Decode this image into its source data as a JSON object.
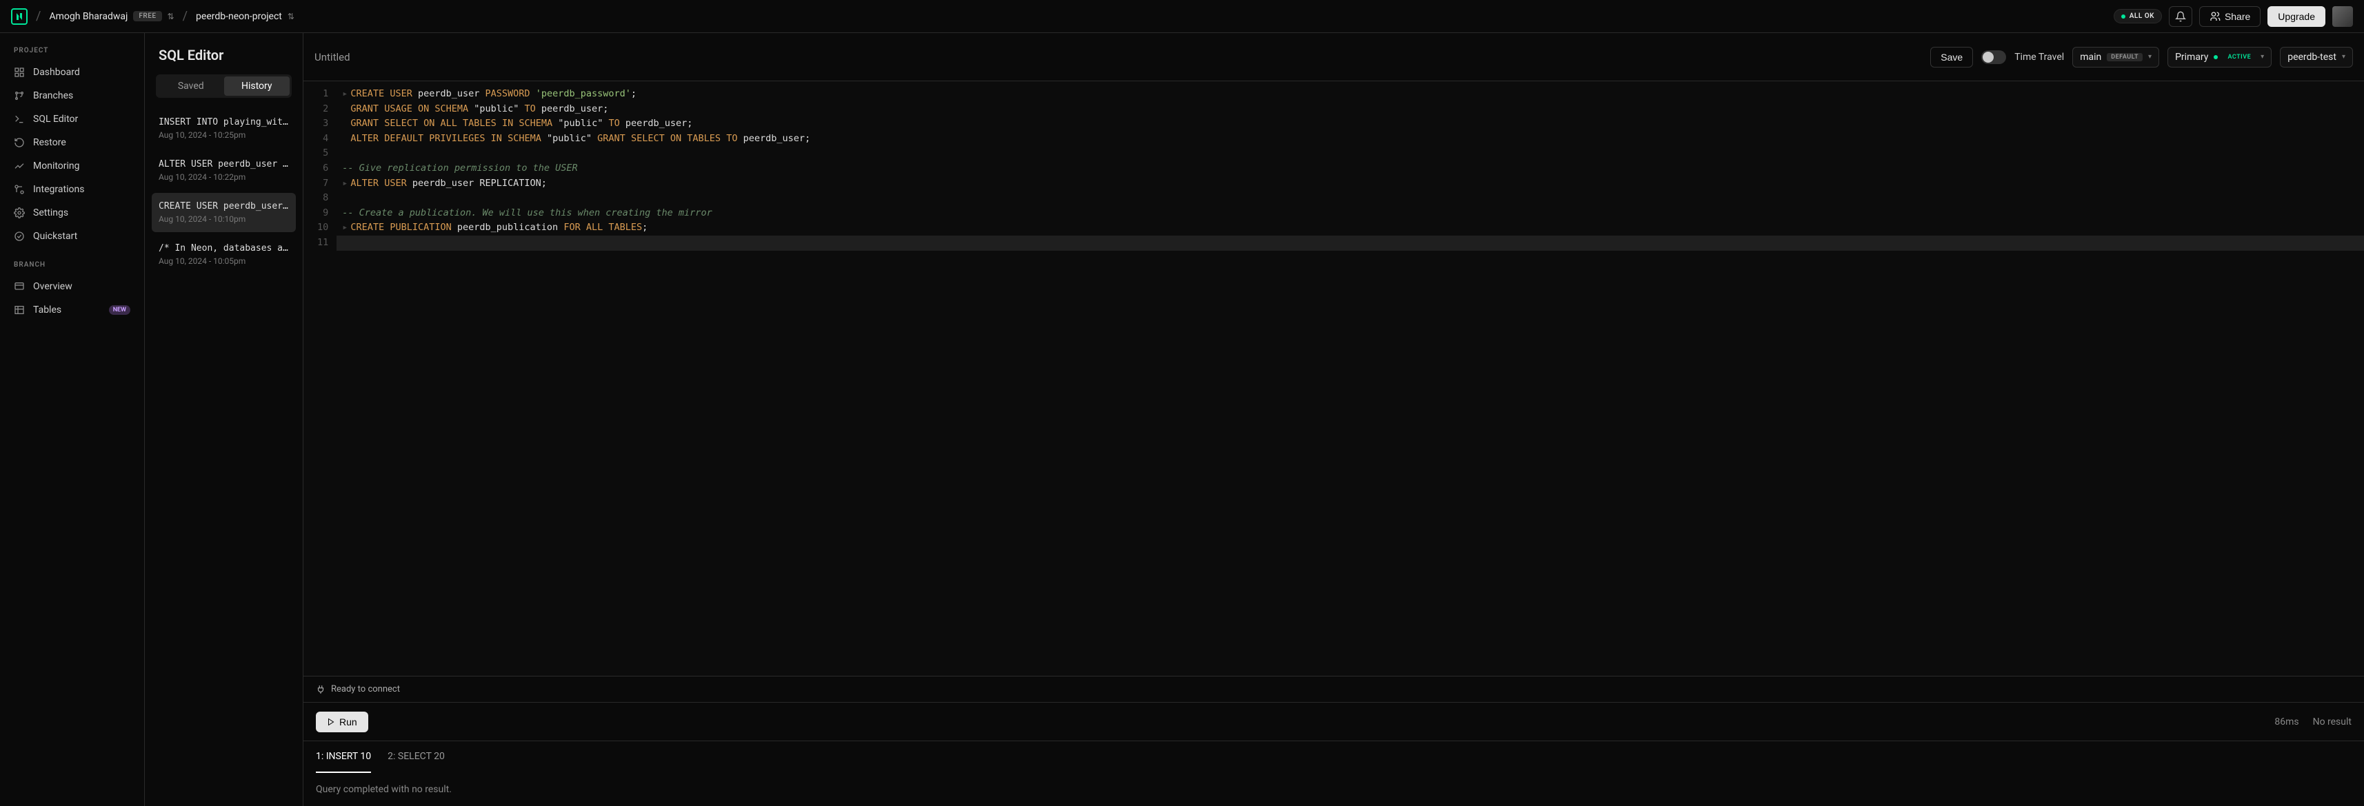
{
  "header": {
    "user_name": "Amogh Bharadwaj",
    "plan_badge": "FREE",
    "project_name": "peerdb-neon-project",
    "status_label": "ALL OK",
    "share_label": "Share",
    "upgrade_label": "Upgrade"
  },
  "sidebar": {
    "section_project": "PROJECT",
    "section_branch": "BRANCH",
    "items": {
      "dashboard": "Dashboard",
      "branches": "Branches",
      "sql_editor": "SQL Editor",
      "restore": "Restore",
      "monitoring": "Monitoring",
      "integrations": "Integrations",
      "settings": "Settings",
      "quickstart": "Quickstart",
      "overview": "Overview",
      "tables": "Tables"
    },
    "new_badge": "NEW"
  },
  "history_panel": {
    "title": "SQL Editor",
    "tab_saved": "Saved",
    "tab_history": "History",
    "items": [
      {
        "query": "INSERT INTO playing_wit…",
        "time": "Aug 10, 2024 - 10:25pm"
      },
      {
        "query": "ALTER USER peerdb_user …",
        "time": "Aug 10, 2024 - 10:22pm"
      },
      {
        "query": "CREATE USER peerdb_user…",
        "time": "Aug 10, 2024 - 10:10pm"
      },
      {
        "query": "/* In Neon, databases a…",
        "time": "Aug 10, 2024 - 10:05pm"
      }
    ]
  },
  "editor": {
    "title": "Untitled",
    "save_label": "Save",
    "time_travel_label": "Time Travel",
    "branch_name": "main",
    "branch_badge": "DEFAULT",
    "compute_label": "Primary",
    "compute_status": "ACTIVE",
    "database_name": "peerdb-test",
    "lines": [
      "1",
      "2",
      "3",
      "4",
      "5",
      "6",
      "7",
      "8",
      "9",
      "10",
      "11"
    ],
    "code": {
      "l1": {
        "a": "CREATE",
        "b": "USER",
        "c": "peerdb_user",
        "d": "PASSWORD",
        "e": "'peerdb_password'",
        "f": ";"
      },
      "l2": {
        "a": "GRANT",
        "b": "USAGE",
        "c": "ON",
        "d": "SCHEMA",
        "e": "\"public\"",
        "f": "TO",
        "g": "peerdb_user;"
      },
      "l3": {
        "a": "GRANT",
        "b": "SELECT",
        "c": "ON",
        "d": "ALL",
        "e": "TABLES",
        "f": "IN",
        "g": "SCHEMA",
        "h": "\"public\"",
        "i": "TO",
        "j": "peerdb_user;"
      },
      "l4": {
        "a": "ALTER",
        "b": "DEFAULT",
        "c": "PRIVILEGES",
        "d": "IN",
        "e": "SCHEMA",
        "f": "\"public\"",
        "g": "GRANT",
        "h": "SELECT",
        "i": "ON",
        "j": "TABLES",
        "k": "TO",
        "l": "peerdb_user;"
      },
      "l6": "-- Give replication permission to the USER",
      "l7": {
        "a": "ALTER",
        "b": "USER",
        "c": "peerdb_user REPLICATION;"
      },
      "l9": "-- Create a publication. We will use this when creating the mirror",
      "l10": {
        "a": "CREATE",
        "b": "PUBLICATION",
        "c": "peerdb_publication",
        "d": "FOR",
        "e": "ALL",
        "f": "TABLES",
        "g": ";"
      }
    }
  },
  "status": {
    "ready_label": "Ready to connect"
  },
  "results": {
    "run_label": "Run",
    "time": "86ms",
    "summary": "No result",
    "tabs": [
      {
        "label": "1: INSERT 10"
      },
      {
        "label": "2: SELECT 20"
      }
    ],
    "message": "Query completed with no result."
  }
}
